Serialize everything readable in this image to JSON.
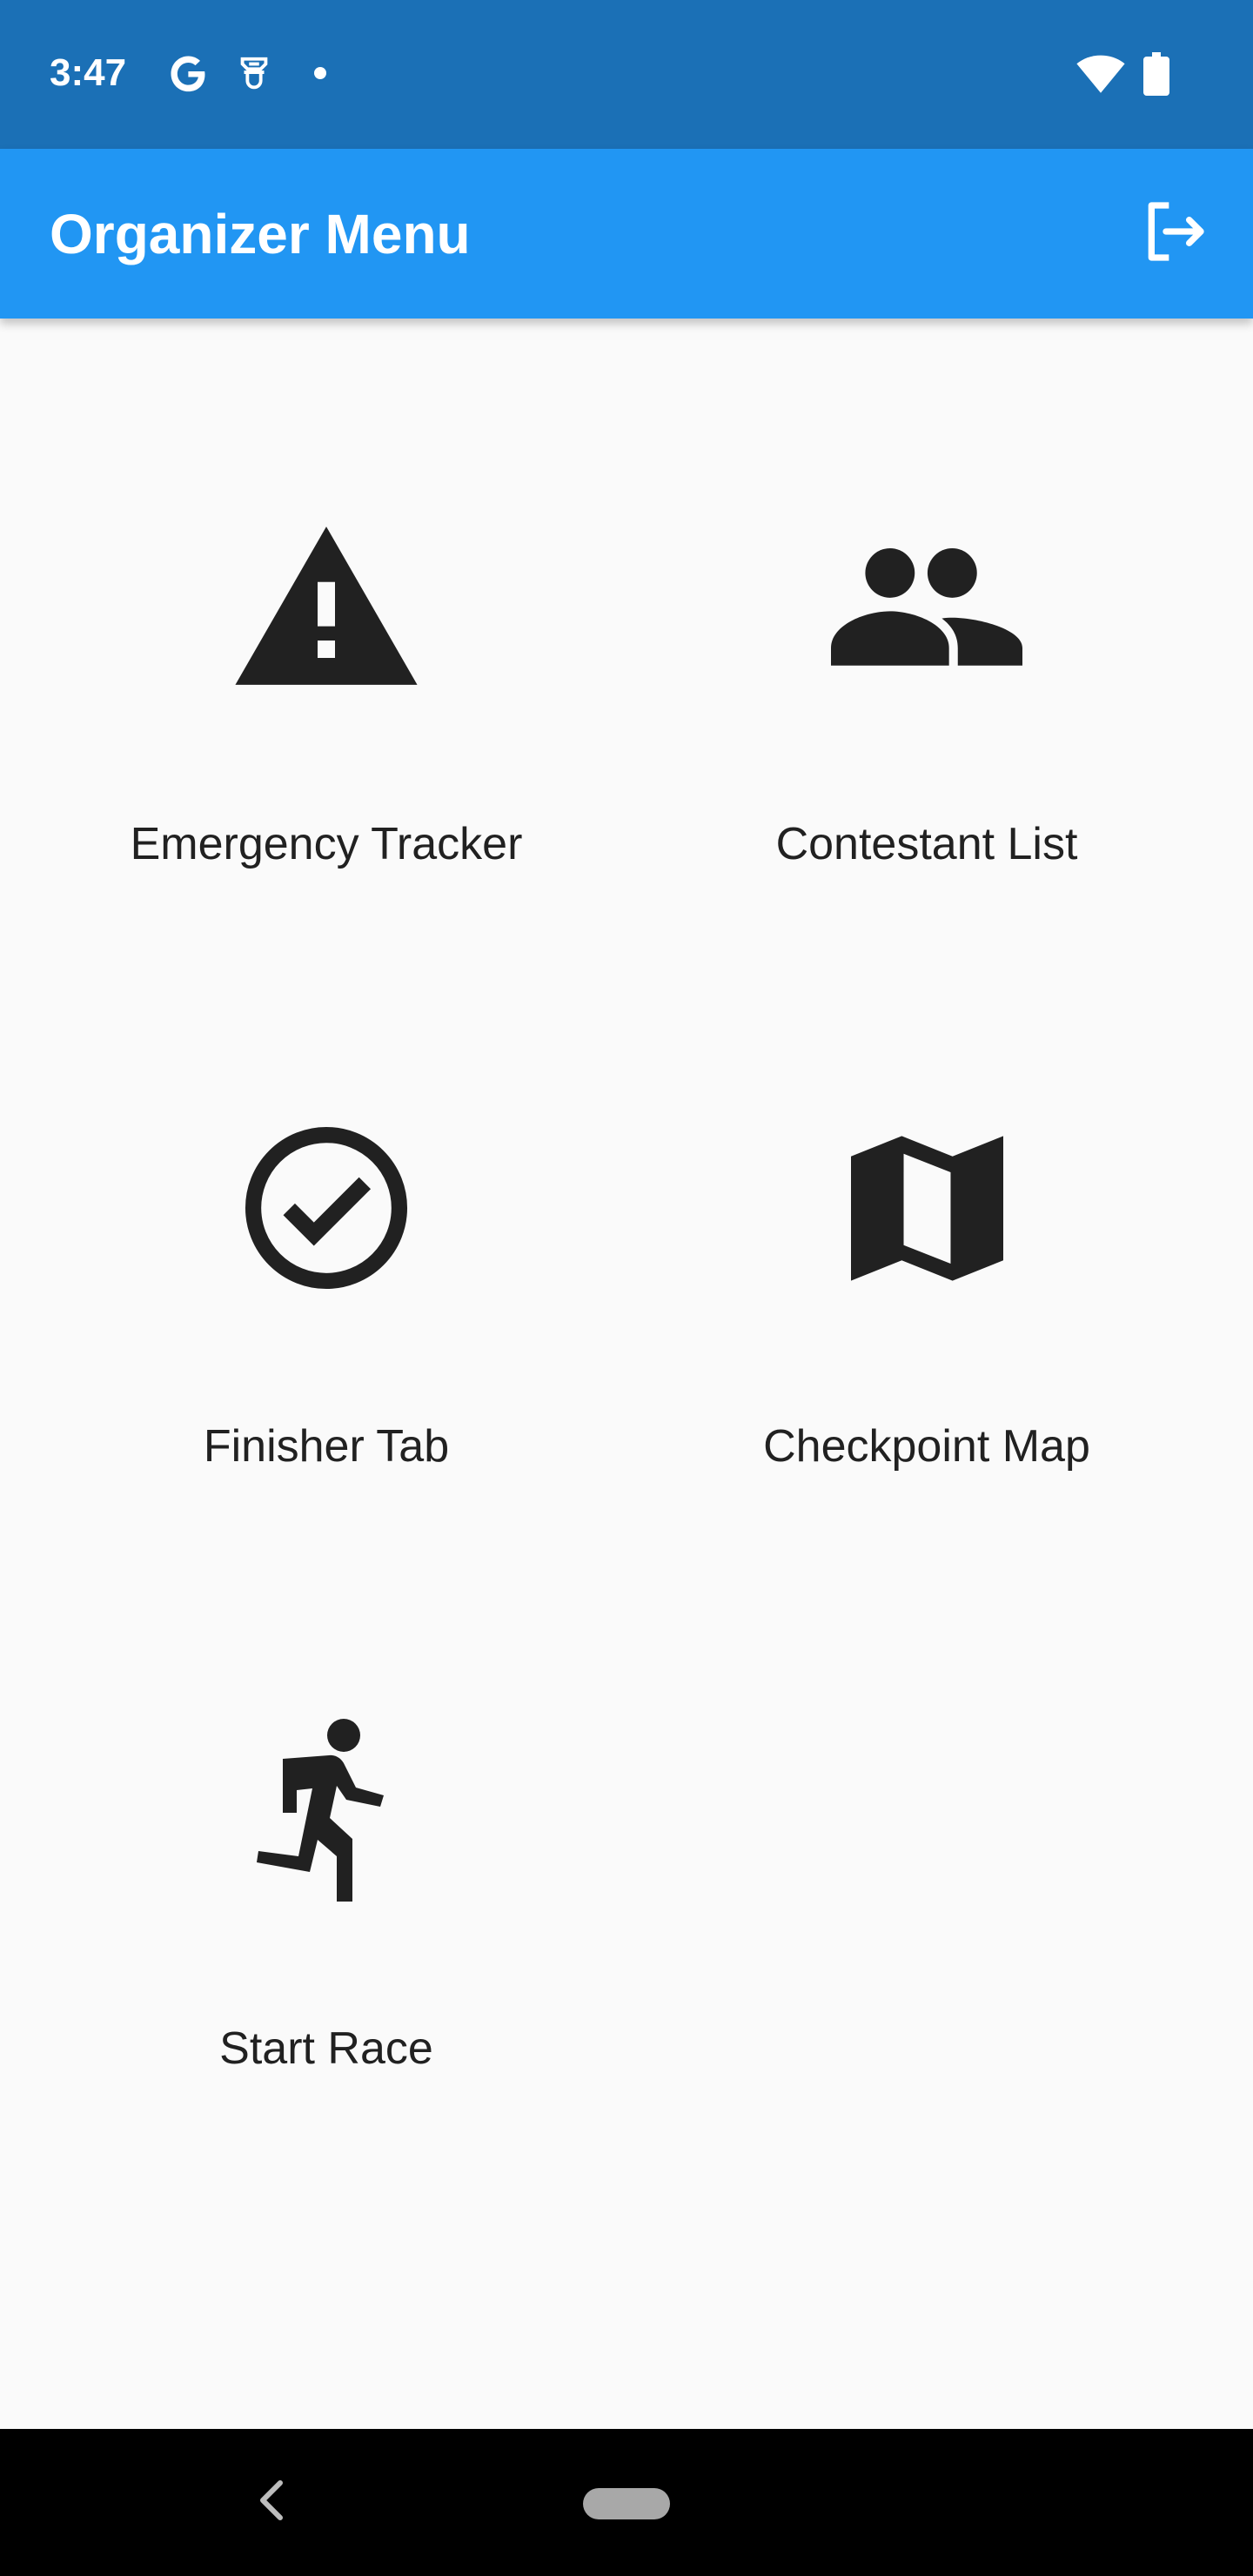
{
  "status_bar": {
    "time": "3:47",
    "background_color": "#1b70b6",
    "icons_left": [
      "google-g-icon",
      "notification-icon",
      "dot-icon"
    ],
    "icons_right": [
      "wifi-icon",
      "battery-icon"
    ]
  },
  "app_bar": {
    "title": "Organizer Menu",
    "background_color": "#2196f3",
    "action_icon": "logout-icon"
  },
  "menu": {
    "items": [
      {
        "label": "Emergency Tracker",
        "icon": "warning-icon"
      },
      {
        "label": "Contestant List",
        "icon": "people-icon"
      },
      {
        "label": "Finisher Tab",
        "icon": "check-circle-icon"
      },
      {
        "label": "Checkpoint Map",
        "icon": "map-icon"
      },
      {
        "label": "Start Race",
        "icon": "running-icon"
      }
    ]
  },
  "nav_bar": {
    "icons": [
      "back-icon",
      "home-pill-icon"
    ]
  }
}
